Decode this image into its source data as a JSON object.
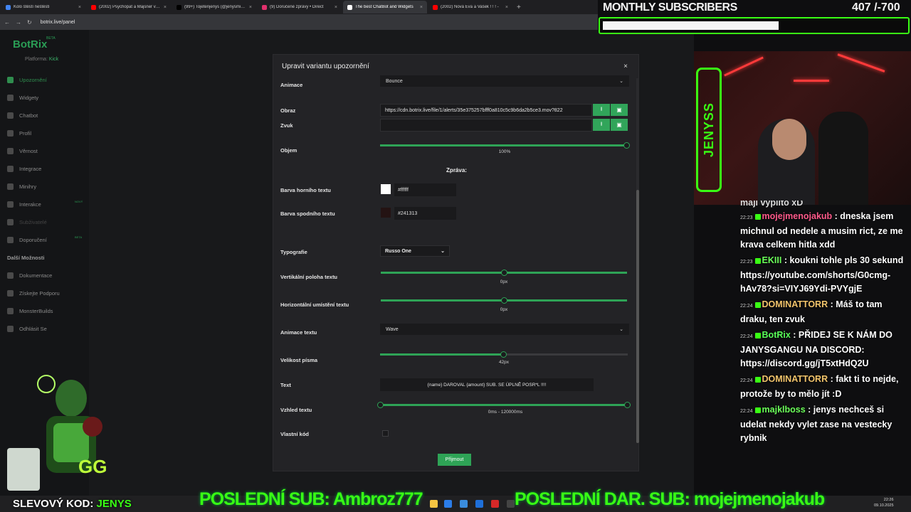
{
  "browser": {
    "tabs": [
      {
        "title": "Kolo štěstí neštěstí",
        "active": false,
        "color": "#4285f4"
      },
      {
        "title": "(2002) Psychopat a Majsner vs...",
        "active": false,
        "color": "#ff0000"
      },
      {
        "title": "(99+) Tojetenjenys (@jenysmin...",
        "active": false,
        "color": "#000000"
      },
      {
        "title": "(9) Doručené zprávy • Direct",
        "active": false,
        "color": "#e1306c"
      },
      {
        "title": "The best ChatBot and Widgets",
        "active": true,
        "color": "#ffffff"
      },
      {
        "title": "(2002) Nová Eva a Vašek ! ! ! -",
        "active": false,
        "color": "#ff0000"
      }
    ],
    "new_tab": "+",
    "url": "botrix.live/panel"
  },
  "sidebar": {
    "logo": "BotRix",
    "beta": "BETA",
    "platform_label": "Platforma:",
    "platform_value": "Kick",
    "items": [
      {
        "label": "Upozornění",
        "active": true,
        "tag": ""
      },
      {
        "label": "Widgety",
        "active": false,
        "tag": ""
      },
      {
        "label": "Chatbot",
        "active": false,
        "tag": ""
      },
      {
        "label": "Profil",
        "active": false,
        "tag": ""
      },
      {
        "label": "Věrnost",
        "active": false,
        "tag": ""
      },
      {
        "label": "Integrace",
        "active": false,
        "tag": ""
      },
      {
        "label": "Minihry",
        "active": false,
        "tag": ""
      },
      {
        "label": "Interakce",
        "active": false,
        "tag": "NOVÝ"
      },
      {
        "label": "Subživatelé",
        "active": false,
        "tag": "",
        "dim": true
      },
      {
        "label": "Doporučení",
        "active": false,
        "tag": "BETA"
      }
    ],
    "more_heading": "Další Možnosti",
    "more_items": [
      {
        "label": "Dokumentace"
      },
      {
        "label": "Získejte Podporu"
      },
      {
        "label": "MonsterBuilds"
      },
      {
        "label": "Odhlásit Se"
      }
    ]
  },
  "modal": {
    "title": "Upravit variantu upozornění",
    "close": "×",
    "animation_label": "Animace",
    "animation_value": "Bounce",
    "image_label": "Obraz",
    "image_url": "https://cdn.botrix.live/file/1/alerts/35e375257bfff0a810c5c9b6da2b5ce3.mov?822",
    "sound_label": "Zvuk",
    "sound_value": "",
    "volume_label": "Objem",
    "volume_value": "100%",
    "volume_fraction": 1.0,
    "message_heading": "Zpráva:",
    "top_color_label": "Barva horního textu",
    "top_color_hex": "#ffffff",
    "bottom_color_label": "Barva spodního textu",
    "bottom_color_hex": "#241313",
    "typography_label": "Typografie",
    "typography_value": "Russo One",
    "vertical_label": "Vertikální poloha textu",
    "vertical_value": "0px",
    "vertical_fraction": 0.5,
    "horizontal_label": "Horizontální umístění textu",
    "horizontal_value": "0px",
    "horizontal_fraction": 0.5,
    "text_anim_label": "Animace textu",
    "text_anim_value": "Wave",
    "font_size_label": "Velikost písma",
    "font_size_value": "42px",
    "font_size_fraction": 0.5,
    "text_label": "Text",
    "text_value": "{name} DAROVAL {amount} SUB. SE ÚPLNĚ POSR*L !!!!",
    "look_label": "Vzhled textu",
    "look_value": "0ms - 120000ms",
    "custom_code_label": "Vlastní kód",
    "submit": "Přijmout"
  },
  "stream": {
    "monthly_title": "MONTHLY SUBSCRIBERS",
    "monthly_count": "407 /-700",
    "monthly_fraction": 0.58,
    "jenyss_logo": "JENYSS",
    "slevovy_prefix": "SLEVOVÝ KOD:",
    "slevovy_code": "JENYS",
    "last_sub": "POSLEDNÍ SUB: Ambroz777",
    "last_gift": "POSLEDNÍ DAR. SUB: mojejmenojakub",
    "ghost_label": "Vlastní kód",
    "accent": "#39ff14"
  },
  "chat": {
    "partial": "maji vyplito xD",
    "messages": [
      {
        "time": "22:23",
        "user": "mojejmenojakub",
        "color": "#ff5a8a",
        "text": ": dneska jsem michnul od nedele a musim rict, ze me krava celkem hitla xdd"
      },
      {
        "time": "22:23",
        "user": "EKIII",
        "color": "#6cff5a",
        "text": ": koukni tohle pls 30 sekund https://youtube.com/shorts/G0cmg-hAv78?si=VIYJ69Ydi-PVYgjE"
      },
      {
        "time": "22:24",
        "user": "DOMINATTORR",
        "color": "#f2c46b",
        "text": ": Máš to tam draku, ten zvuk"
      },
      {
        "time": "22:24",
        "user": "BotRix",
        "color": "#59ff59",
        "text": ": PŘIDEJ SE K NÁM DO JANYSGANGU NA DISCORD: https://discord.gg/jT5xtHdQ2U"
      },
      {
        "time": "22:24",
        "user": "DOMINATTORR",
        "color": "#f2c46b",
        "text": ": fakt ti to nejde, protože by to mělo jít :D"
      },
      {
        "time": "22:24",
        "user": "majklboss",
        "color": "#6cff5a",
        "text": ": jenys nechceš si udelat nekdy vylet zase na vestecky rybnik"
      }
    ]
  },
  "taskbar": {
    "time": "22:26",
    "date": "09.10.2025"
  }
}
